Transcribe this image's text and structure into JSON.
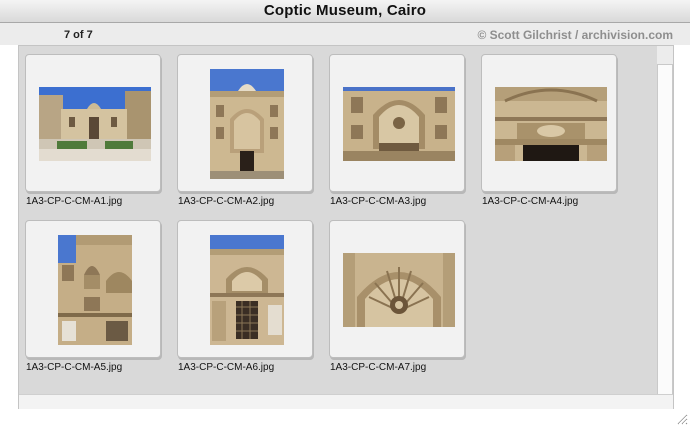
{
  "window": {
    "title": "Coptic Museum, Cairo",
    "counter": "7 of 7",
    "credit": "© Scott Gilchrist / archivision.com"
  },
  "colors": {
    "sky": "#3a67c8",
    "stone": "#c9b48f",
    "stone_dark": "#8a7554",
    "shadow": "#2b2018"
  },
  "thumbnails": [
    {
      "filename": "1A3-CP-C-CM-A1.jpg",
      "subject": "museum facade and courtyard"
    },
    {
      "filename": "1A3-CP-C-CM-A2.jpg",
      "subject": "carved portal with dome"
    },
    {
      "filename": "1A3-CP-C-CM-A3.jpg",
      "subject": "shell niche arch detail"
    },
    {
      "filename": "1A3-CP-C-CM-A4.jpg",
      "subject": "carved frieze above doorway"
    },
    {
      "filename": "1A3-CP-C-CM-A5.jpg",
      "subject": "facade niches detail"
    },
    {
      "filename": "1A3-CP-C-CM-A6.jpg",
      "subject": "mashrabiya window under arch"
    },
    {
      "filename": "1A3-CP-C-CM-A7.jpg",
      "subject": "scalloped shell hood"
    }
  ]
}
